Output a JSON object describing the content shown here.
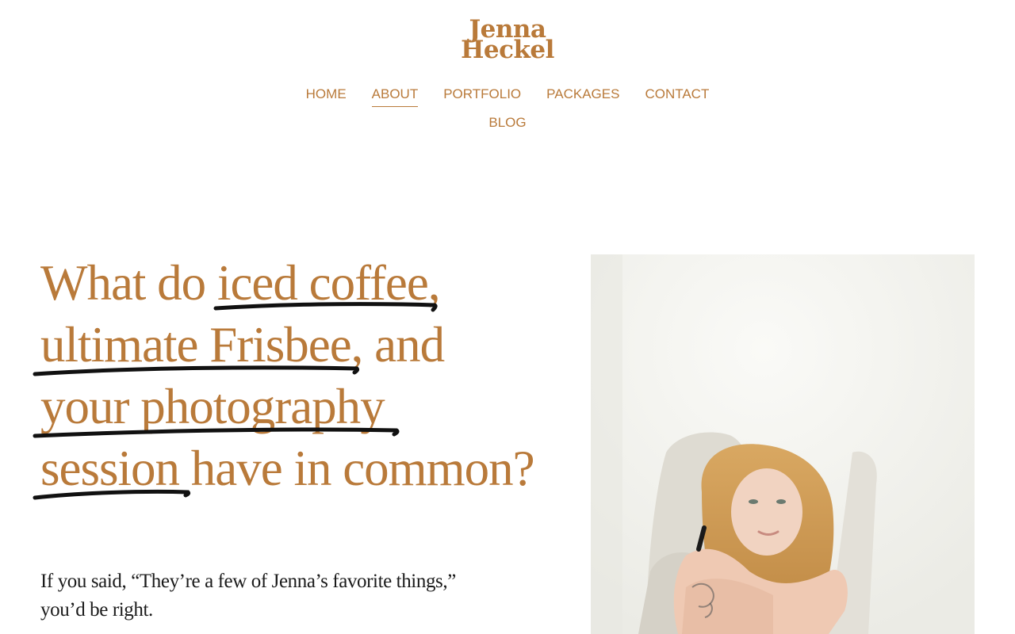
{
  "site": {
    "logo_line1": "Jenna",
    "logo_line2": "Heckel"
  },
  "nav": {
    "items": [
      "HOME",
      "ABOUT",
      "PORTFOLIO",
      "PACKAGES",
      "CONTACT",
      "BLOG"
    ],
    "active": "ABOUT"
  },
  "hero": {
    "headline_parts": [
      "What do ",
      "iced coffee,",
      "ultimate Frisbee,",
      " and",
      "your photography",
      "session",
      " have in common?"
    ],
    "intro": "If you said, “They’re a few of Jenna’s favorite things,” you’d be right."
  },
  "photo": {
    "alt": "Portrait of a woman with curly blonde hair sitting on a white pouf, arms crossed over her knees"
  },
  "colors": {
    "accent": "#b97a3a",
    "text": "#1b1b1b",
    "scribble": "#111111"
  }
}
